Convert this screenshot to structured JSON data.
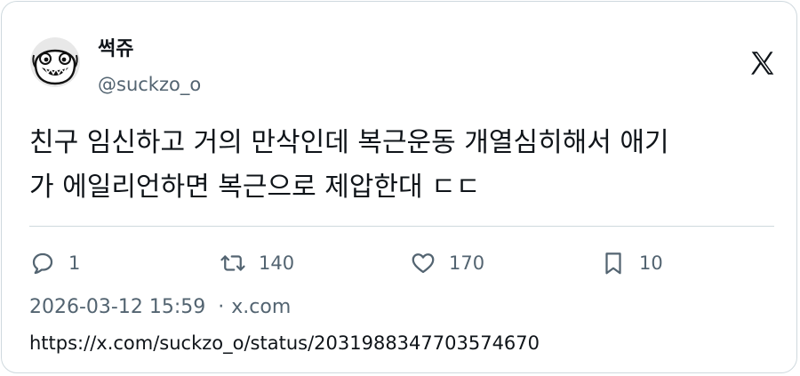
{
  "author": {
    "display_name": "썩쥬",
    "handle": "@suckzo_o"
  },
  "icons": {
    "avatar": "cartoon-face-avatar",
    "brand": "x-logo-icon",
    "reply": "speech-bubble-icon",
    "repost": "repost-arrows-icon",
    "like": "heart-icon",
    "bookmark": "bookmark-icon"
  },
  "tweet": {
    "text_line1": "친구 임신하고 거의 만삭인데 복근운동 개열심히해서 애기",
    "text_line2": "가 에일리언하면 복근으로 제압한대 ㄷㄷ"
  },
  "actions": {
    "reply_count": "1",
    "repost_count": "140",
    "like_count": "170",
    "bookmark_count": "10"
  },
  "meta": {
    "timestamp": "2026-03-12 15:59",
    "separator": "·",
    "source": "x.com",
    "url": "https://x.com/suckzo_o/status/2031988347703574670"
  },
  "colors": {
    "text_primary": "#0f1419",
    "text_secondary": "#536471",
    "border": "#cfd9de"
  }
}
